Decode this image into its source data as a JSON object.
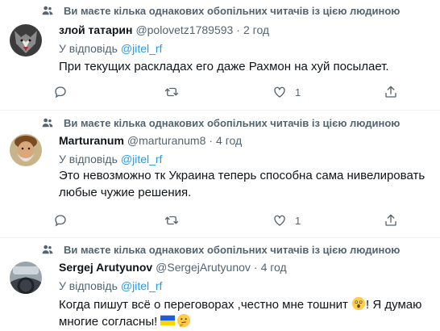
{
  "context_text": "Ви маєте кілька однакових обопільних читачів із цією людиною",
  "reply_prefix": "У відповідь",
  "separator": "·",
  "tweets": [
    {
      "name": "злой татарин",
      "handle": "@polovetz1789593",
      "time": "2 год",
      "reply_to": "@jitel_rf",
      "text": "При текущих раскладах его даже Рахмон на хуй посылает.",
      "likes": "1"
    },
    {
      "name": "Marturanum",
      "handle": "@marturanum8",
      "time": "4 год",
      "reply_to": "@jitel_rf",
      "text": "Это невозможно тк Украина теперь способна сама нивелировать любые чужие решения.",
      "likes": "1"
    },
    {
      "name": "Sergej Arutyunov",
      "handle": "@SergejArutyunov",
      "time": "4 год",
      "reply_to": "@jitel_rf",
      "text_part1": "Когда пишут всё о переговорах  ,честно мне тошнит",
      "text_part2": "! Я думаю многие согласны!",
      "emojis": [
        "astonished-face-emoji",
        "ukraine-flag-emoji",
        "thinking-face-emoji"
      ]
    }
  ],
  "icons": {
    "context": "people-icon",
    "reply": "reply-icon",
    "retweet": "retweet-icon",
    "like": "heart-icon",
    "share": "share-icon"
  },
  "colors": {
    "accent": "#1d9bf0",
    "secondary_text": "#536471",
    "primary_text": "#0f1419",
    "divider": "#eff3f4"
  }
}
